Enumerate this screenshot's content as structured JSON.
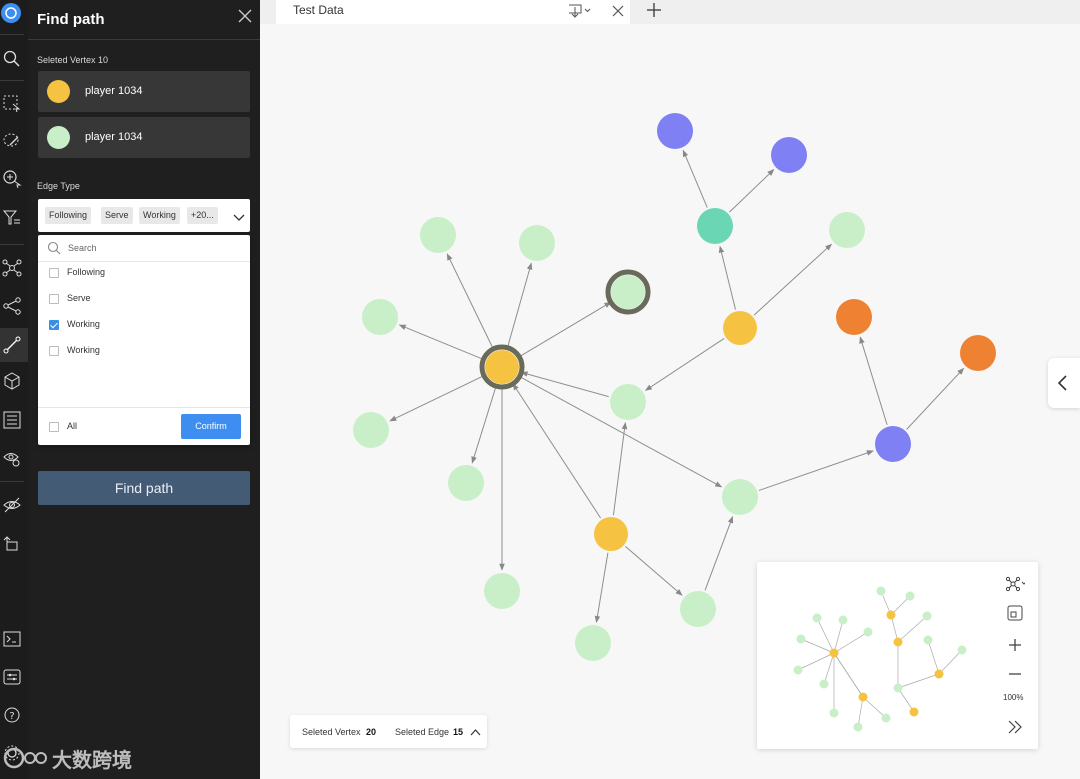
{
  "panel": {
    "title": "Find path",
    "selected_vertex_label": "Seleted Vertex 10",
    "vertices": [
      {
        "label": "player 1034",
        "color": "#f5c242"
      },
      {
        "label": "player 1034",
        "color": "#c8efc8"
      }
    ],
    "edge_type_label": "Edge Type",
    "selected_tags": [
      "Following",
      "Serve",
      "Working",
      "+20..."
    ],
    "dropdown": {
      "search_placeholder": "Search",
      "options": [
        {
          "label": "Following",
          "checked": false
        },
        {
          "label": "Serve",
          "checked": false
        },
        {
          "label": "Working",
          "checked": true
        },
        {
          "label": "Working",
          "checked": false
        }
      ],
      "all_label": "All",
      "confirm_label": "Confirm"
    },
    "find_path_button": "Find path"
  },
  "tab": {
    "title": "Test Data"
  },
  "status": {
    "vertex_label": "Seleted Vertex",
    "vertex_count": "20",
    "edge_label": "Seleted Edge",
    "edge_count": "15"
  },
  "minimap": {
    "zoom": "100%"
  },
  "watermark": {
    "text": "大数跨境"
  },
  "colors": {
    "accent": "#3d8ef0",
    "player": "#f5c242",
    "light": "#c8efc8",
    "purple": "#8080f5",
    "teal": "#6ad6b4",
    "orange": "#ee8232"
  },
  "icons": [
    "search-icon",
    "select-box-icon",
    "lasso-icon",
    "explore-icon",
    "filter-icon",
    "network-icon",
    "share-icon",
    "path-icon",
    "cube-icon",
    "list-icon",
    "eye-search-icon",
    "hide-icon",
    "undo-icon",
    "terminal-icon",
    "settings-list-icon",
    "help-icon",
    "gear-icon"
  ]
}
